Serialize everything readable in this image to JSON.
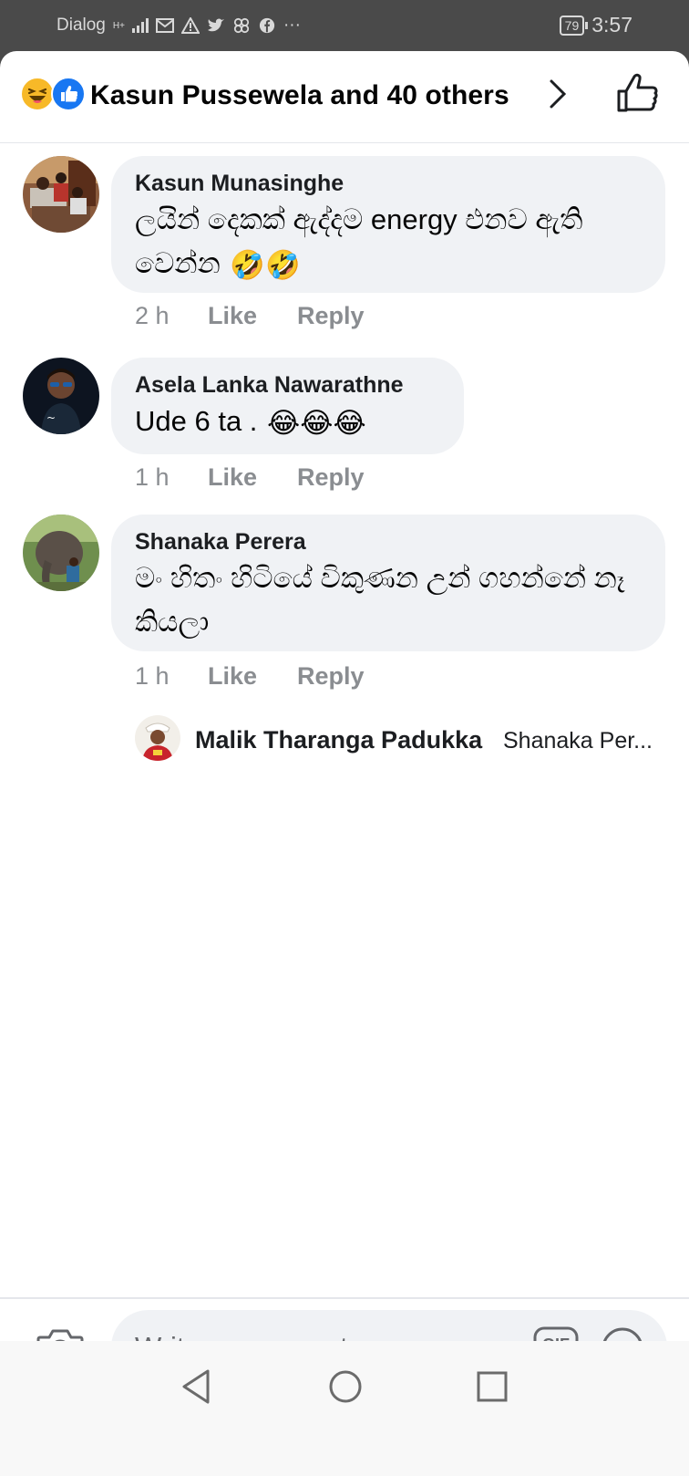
{
  "status_bar": {
    "carrier": "Dialog",
    "network": "H+",
    "battery": "79",
    "time": "3:57"
  },
  "header": {
    "reactions": [
      "haha-icon",
      "like-icon"
    ],
    "title": "Kasun Pussewela and 40 others"
  },
  "comments": [
    {
      "name": "Kasun Munasinghe",
      "text": "ලයින් දෙකක් ඇද්දම energy එනව ඇති වෙන්න",
      "emoji": "🤣🤣",
      "time": "2 h",
      "like": "Like",
      "reply": "Reply"
    },
    {
      "name": "Asela Lanka Nawarathne",
      "text": "Ude 6 ta .",
      "emoji": "😂😂😂",
      "time": "1 h",
      "like": "Like",
      "reply": "Reply"
    },
    {
      "name": "Shanaka Perera",
      "text": "මං හිතං හිටියේ විකුණන උන් ගහන්නේ නෑ කියලා",
      "emoji": "",
      "time": "1 h",
      "like": "Like",
      "reply": "Reply"
    }
  ],
  "reply_preview": {
    "name": "Malik Tharanga Padukka",
    "text": "Shanaka Per..."
  },
  "composer": {
    "placeholder": "Write a comment...",
    "gif_label": "GIF"
  },
  "colors": {
    "bubble": "#f0f2f5",
    "accent": "#1877f2",
    "secondary_text": "#8a8d91"
  }
}
